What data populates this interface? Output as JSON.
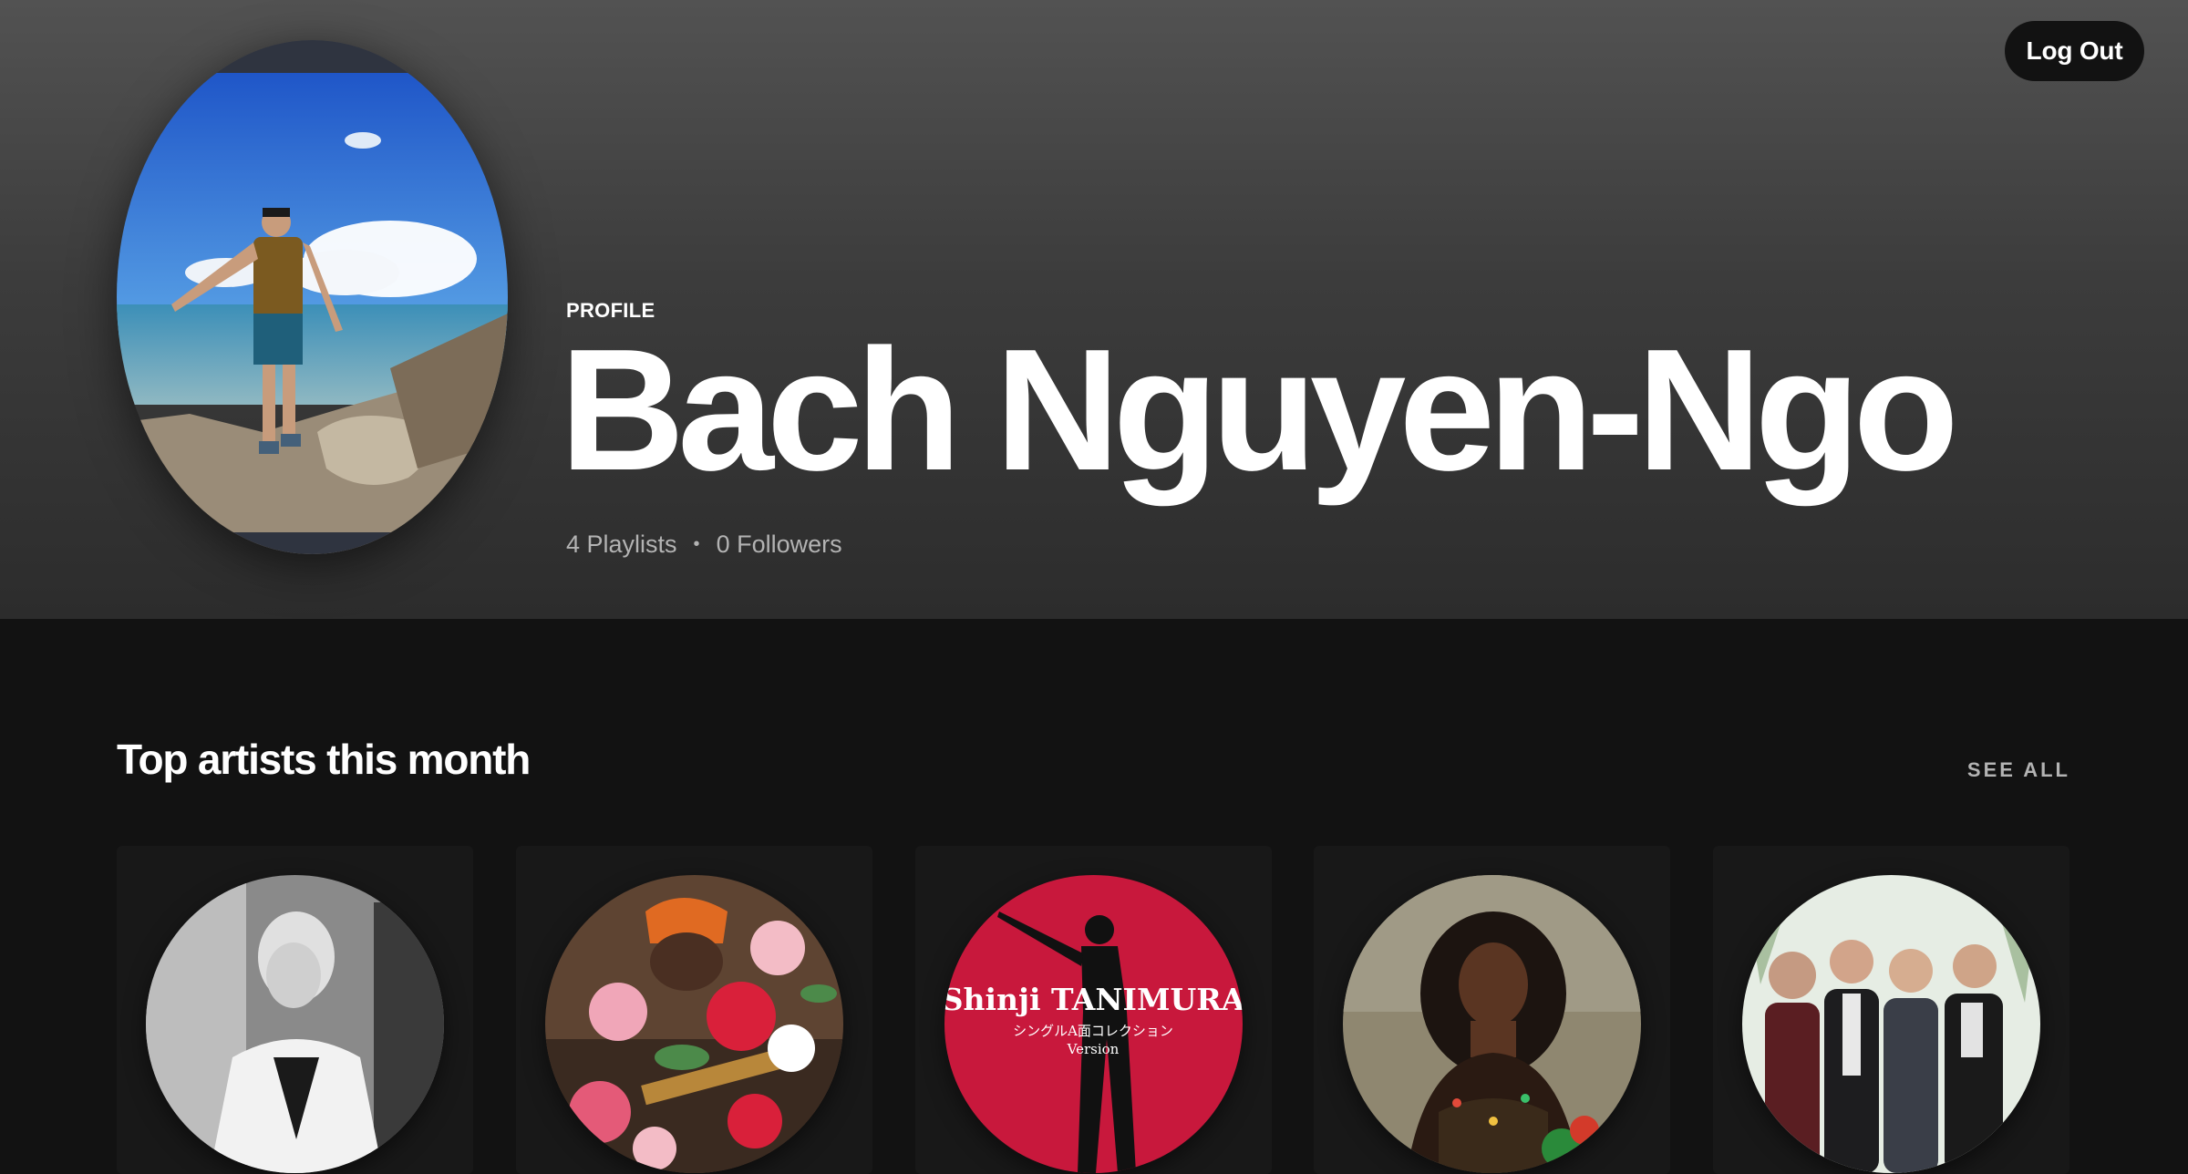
{
  "header": {
    "logout_label": "Log Out",
    "profile_label": "PROFILE",
    "display_name": "Bach Nguyen-Ngo",
    "playlists": "4 Playlists",
    "separator": "•",
    "followers": "0 Followers"
  },
  "top_artists": {
    "title": "Top artists this month",
    "see_all_label": "SEE ALL",
    "artists": [
      {
        "image_icon": "artist-portrait-bw"
      },
      {
        "image_icon": "artist-portrait-flowers"
      },
      {
        "image_icon": "artist-shinji-tanimura-cover",
        "cover_text": "Shinji TANIMURA",
        "cover_subtext": "シングルA面コレクション",
        "cover_subtext2": "Version"
      },
      {
        "image_icon": "artist-portrait-singer"
      },
      {
        "image_icon": "artist-band-photo"
      }
    ]
  },
  "colors": {
    "background": "#121212",
    "card": "#181818",
    "header_top": "#525252",
    "secondary_text": "#b3b3b3",
    "tanimura_red": "#c8183c"
  }
}
